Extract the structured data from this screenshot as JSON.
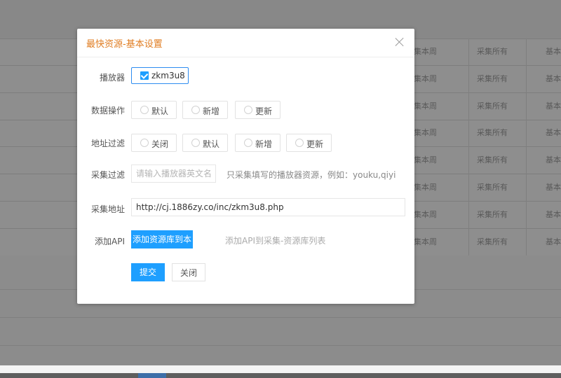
{
  "background": {
    "table_rows": [
      {
        "col1": "集本周",
        "col2": "采集所有",
        "col3": "基本"
      },
      {
        "col1": "集本周",
        "col2": "采集所有",
        "col3": "基本"
      },
      {
        "col1": "集本周",
        "col2": "采集所有",
        "col3": "基本"
      },
      {
        "col1": "集本周",
        "col2": "采集所有",
        "col3": "基本"
      },
      {
        "col1": "集本周",
        "col2": "采集所有",
        "col3": "基本"
      },
      {
        "col1": "集本周",
        "col2": "采集所有",
        "col3": "基本"
      },
      {
        "col1": "集本周",
        "col2": "采集所有",
        "col3": "基本"
      },
      {
        "col1": "集本周",
        "col2": "采集所有",
        "col3": "基本"
      }
    ]
  },
  "modal": {
    "title": "最快资源-基本设置",
    "player_label": "播放器",
    "player_value": "zkm3u8",
    "data_op_label": "数据操作",
    "data_op_options": [
      "默认",
      "新增",
      "更新"
    ],
    "addr_filter_label": "地址过滤",
    "addr_filter_options": [
      "关闭",
      "默认",
      "新增",
      "更新"
    ],
    "collect_filter_label": "采集过滤",
    "collect_filter_placeholder": "请输入播放器英文名称",
    "collect_filter_hint": "只采集填写的播放器资源，例如：youku,qiyi",
    "collect_url_label": "采集地址",
    "collect_url_value": "http://cj.1886zy.co/inc/zkm3u8.php",
    "add_api_label": "添加API",
    "add_api_button": "添加资源库到本地",
    "add_api_hint": "添加API到采集-资源库列表",
    "submit_button": "提交",
    "close_button": "关闭"
  },
  "colors": {
    "title": "#e07d22",
    "primary": "#1e9fff",
    "overlay": "#8e8e8e"
  }
}
